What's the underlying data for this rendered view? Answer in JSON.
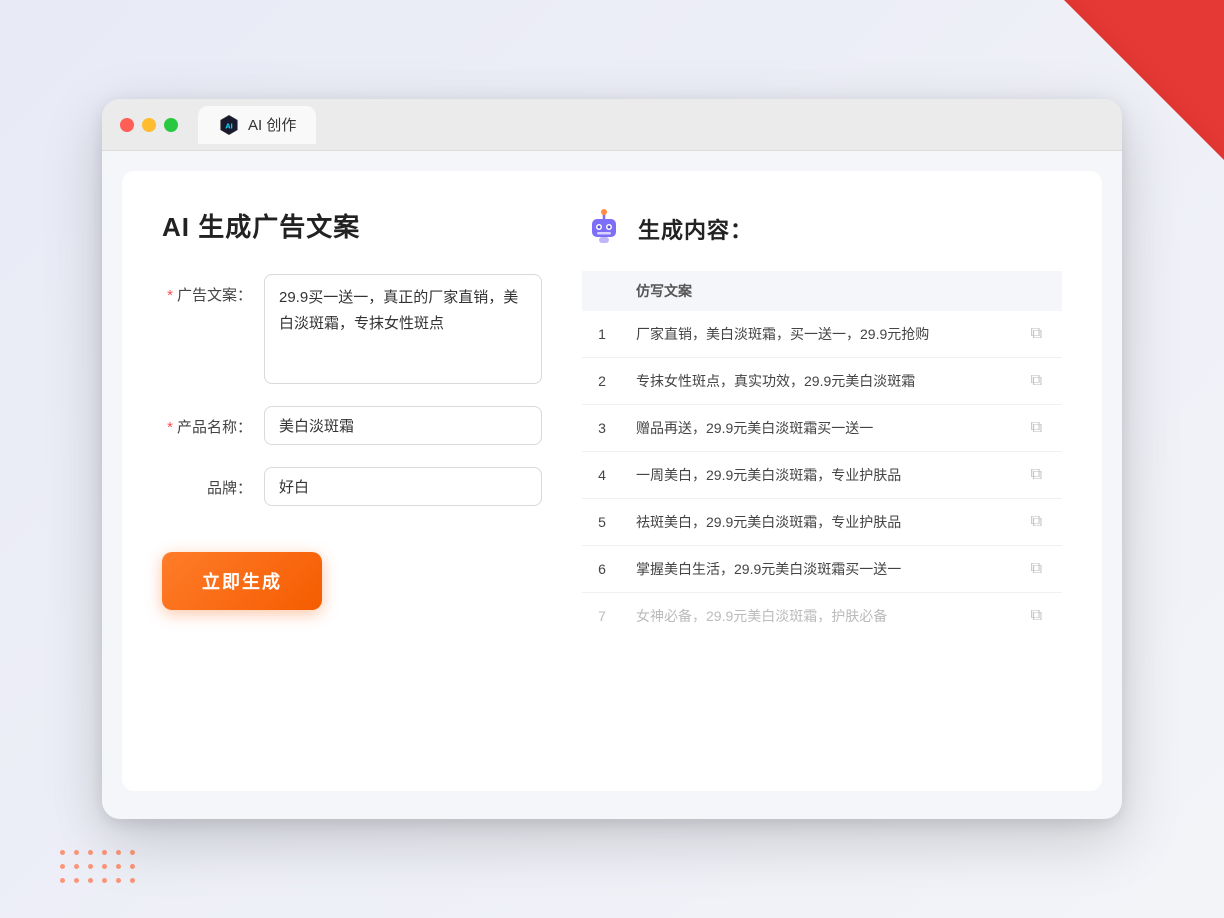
{
  "browser": {
    "tab_label": "AI 创作",
    "traffic_lights": [
      "red",
      "yellow",
      "green"
    ]
  },
  "page": {
    "title": "AI 生成广告文案",
    "form": {
      "ad_copy_label": "广告文案：",
      "ad_copy_required": "*",
      "ad_copy_value": "29.9买一送一，真正的厂家直销，美白淡斑霜，专抹女性斑点",
      "product_name_label": "产品名称：",
      "product_name_required": "*",
      "product_name_value": "美白淡斑霜",
      "brand_label": "品牌：",
      "brand_value": "好白",
      "generate_button": "立即生成"
    },
    "results": {
      "title": "生成内容：",
      "col_header": "仿写文案",
      "items": [
        {
          "id": 1,
          "text": "厂家直销，美白淡斑霜，买一送一，29.9元抢购",
          "faded": false
        },
        {
          "id": 2,
          "text": "专抹女性斑点，真实功效，29.9元美白淡斑霜",
          "faded": false
        },
        {
          "id": 3,
          "text": "赠品再送，29.9元美白淡斑霜买一送一",
          "faded": false
        },
        {
          "id": 4,
          "text": "一周美白，29.9元美白淡斑霜，专业护肤品",
          "faded": false
        },
        {
          "id": 5,
          "text": "祛斑美白，29.9元美白淡斑霜，专业护肤品",
          "faded": false
        },
        {
          "id": 6,
          "text": "掌握美白生活，29.9元美白淡斑霜买一送一",
          "faded": false
        },
        {
          "id": 7,
          "text": "女神必备，29.9元美白淡斑霜，护肤必备",
          "faded": true
        }
      ]
    }
  }
}
